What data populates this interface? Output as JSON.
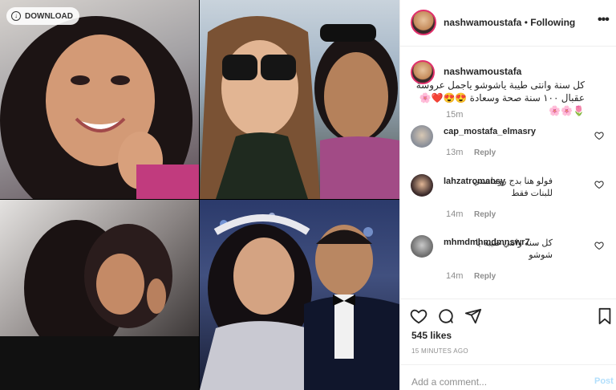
{
  "media": {
    "download_label": "DOWNLOAD",
    "tiles": [
      "photo-tile-1",
      "photo-tile-2",
      "photo-tile-3",
      "photo-tile-4"
    ]
  },
  "post": {
    "username": "nashwamoustafa",
    "separator": "•",
    "follow_status": "Following",
    "more_icon": "more-icon",
    "caption": "كل سنة وانتى طيبة ياشوشو ياجمل عروسة عقبال ١٠٠ سنة صحة وسعادة 😍😍❤️🌸🌷🌸🌸",
    "caption_time": "15m"
  },
  "comments": [
    {
      "username": "cap_mostafa_elmasry",
      "text": "",
      "time": "13m",
      "reply": "Reply"
    },
    {
      "username": "lahzatromansy",
      "text": "فولو هنا بدج رومانسي للبنات فقط",
      "time": "14m",
      "reply": "Reply"
    },
    {
      "username": "mhmdmhmdmnswr7",
      "text": "كل سنه وانتي طيبه يا شوشو",
      "time": "14m",
      "reply": "Reply"
    }
  ],
  "actions": {
    "icons": [
      "heart-icon",
      "comment-icon",
      "share-icon",
      "bookmark-icon"
    ]
  },
  "likes": "545 likes",
  "timestamp": "15 MINUTES AGO",
  "add_comment": {
    "placeholder": "Add a comment...",
    "post_label": "Post"
  },
  "colors": {
    "link_blue": "#b2dffc",
    "muted": "#8e8e8e",
    "text": "#262626",
    "story_ring": "#e1306c"
  }
}
